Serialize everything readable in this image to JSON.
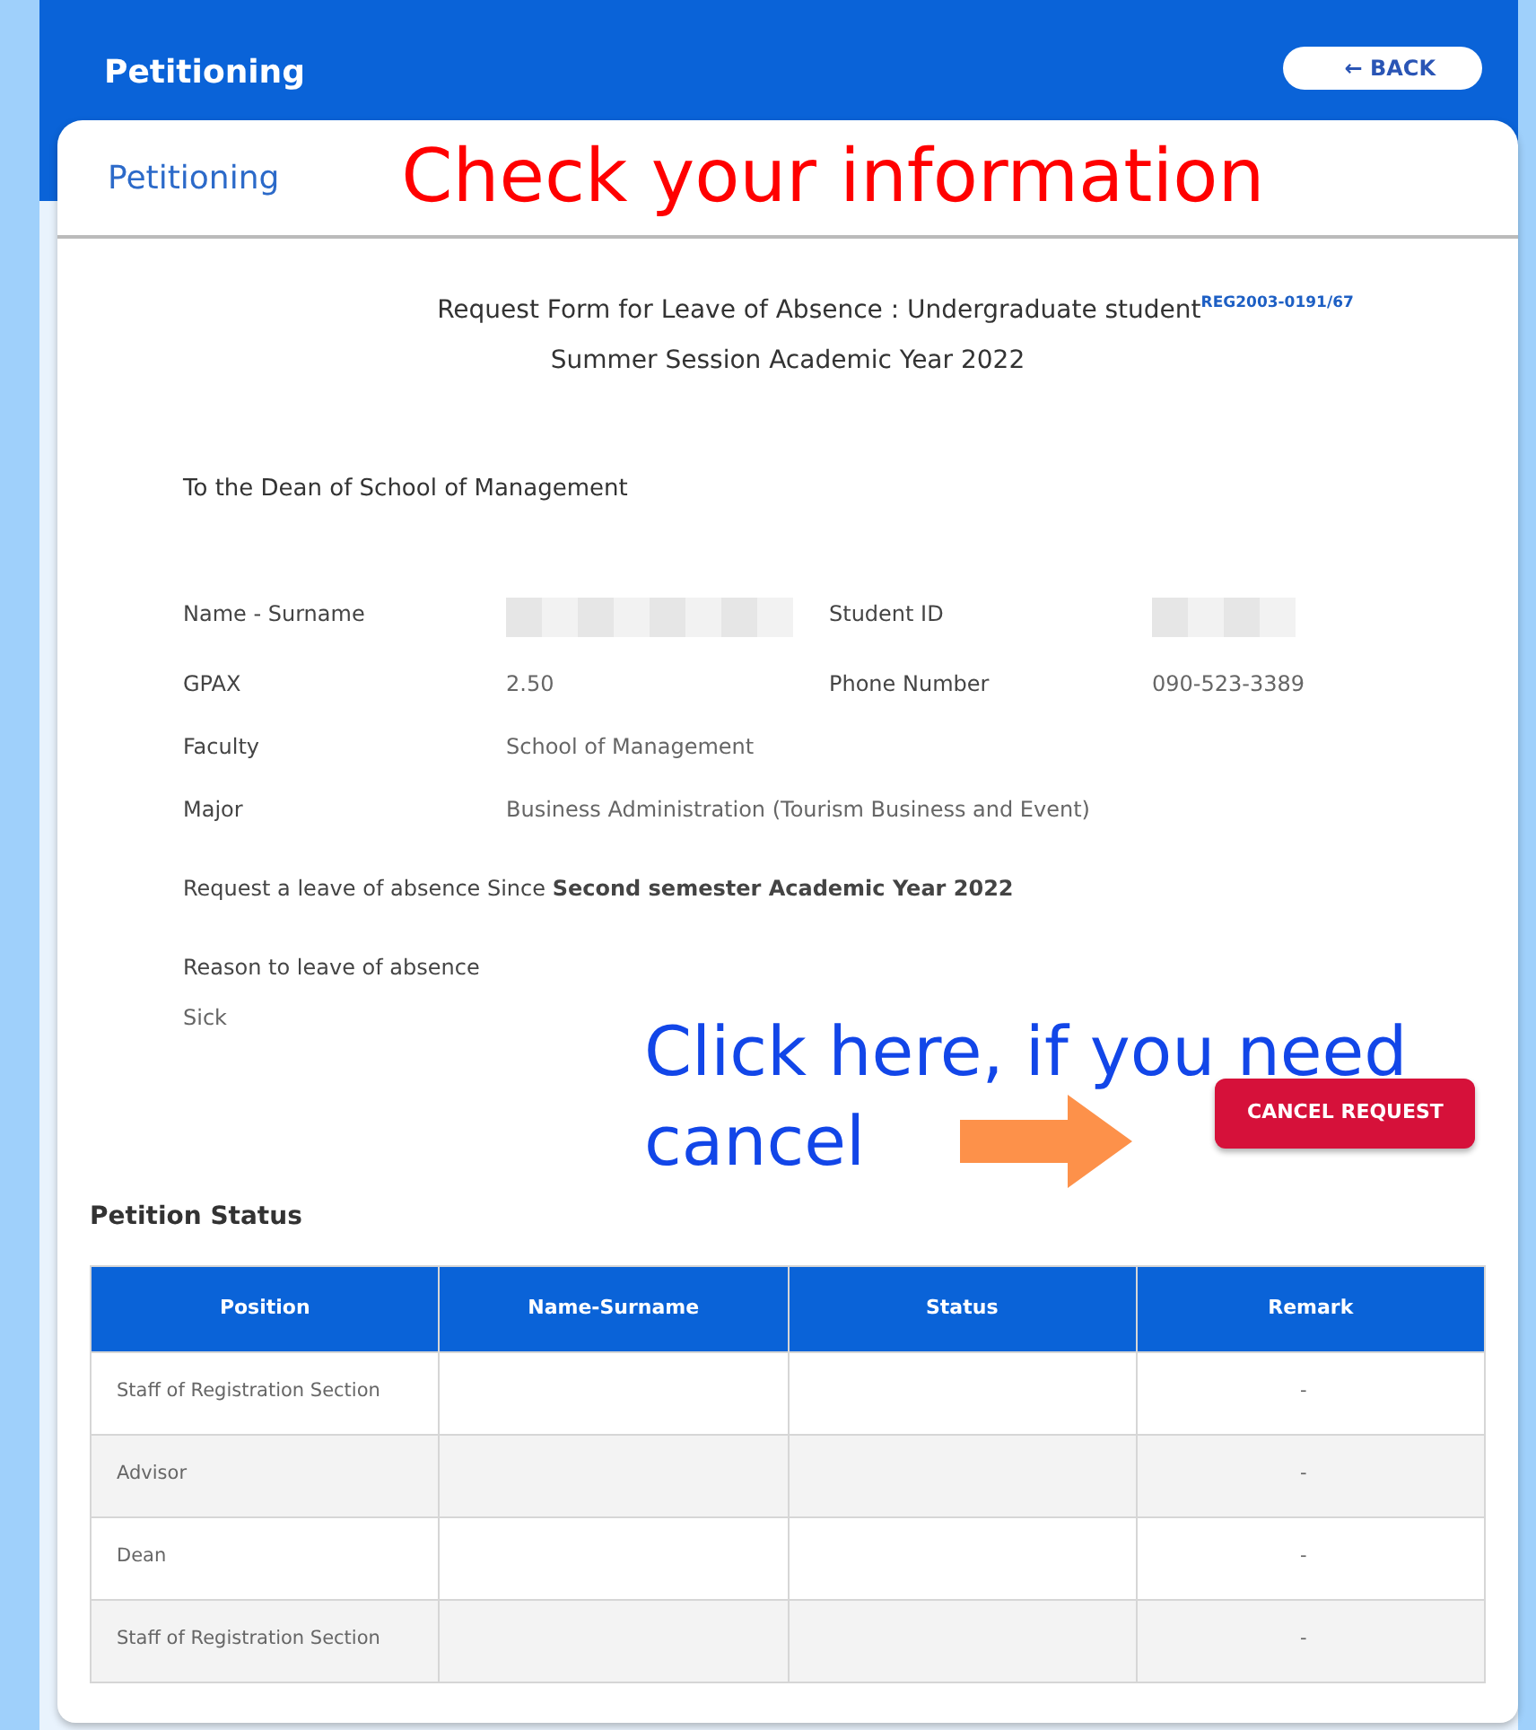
{
  "header": {
    "title": "Petitioning",
    "back_button": "← BACK"
  },
  "tab": {
    "label": "Petitioning"
  },
  "annotations": [
    {
      "kind": "heading",
      "text": "Check your information"
    },
    {
      "kind": "hint",
      "text": "Click here, if you need"
    },
    {
      "kind": "hint",
      "text": "cancel"
    }
  ],
  "form": {
    "title": "Request Form for Leave of Absence : Undergraduate student",
    "reference": "REG2003-0191/67",
    "subtitle": "Summer Session  Academic Year 2022",
    "addressee": "To the Dean of School of Management",
    "field_rows": [
      [
        {
          "label": "Name - Surname",
          "kind": "redacted"
        },
        {
          "label": "Student ID",
          "kind": "redacted"
        }
      ],
      [
        {
          "label": "GPAX",
          "kind": "text",
          "value": "2.50"
        },
        {
          "label": "Phone Number",
          "kind": "text",
          "value": "090-523-3389"
        }
      ],
      [
        {
          "label": "Faculty",
          "kind": "text",
          "value": "School of Management"
        }
      ],
      [
        {
          "label": "Major",
          "kind": "text",
          "value": "Business Administration (Tourism Business and Event)"
        }
      ]
    ],
    "request": "Request a leave of absence Since **Second semester Academic Year 2022**",
    "reason_label": "Reason to leave of absence",
    "reason": "Sick"
  },
  "cancel_button": "CANCEL REQUEST",
  "status": {
    "title": "Petition Status",
    "columns": [
      "Position",
      "Name-Surname",
      "Status",
      "Remark"
    ],
    "rows": [
      [
        "Staff of Registration Section",
        "",
        "",
        "-"
      ],
      [
        "Advisor",
        "",
        "",
        "-"
      ],
      [
        "Dean",
        "",
        "",
        "-"
      ],
      [
        "Staff of Registration Section",
        "",
        "",
        "-"
      ]
    ]
  }
}
